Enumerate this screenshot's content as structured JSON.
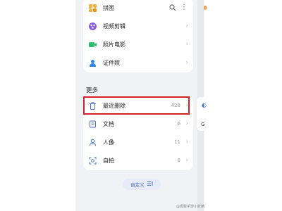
{
  "top_items": [
    {
      "label": "拼图",
      "icon": "puzzle-icon"
    },
    {
      "label": "视频剪辑",
      "icon": "video-edit-icon"
    },
    {
      "label": "照片电影",
      "icon": "movie-icon"
    },
    {
      "label": "证件照",
      "icon": "id-photo-icon"
    }
  ],
  "more": {
    "title": "更多",
    "items": [
      {
        "label": "最近删除",
        "count": "428",
        "icon": "trash-icon"
      },
      {
        "label": "文档",
        "count": "6",
        "icon": "document-icon"
      },
      {
        "label": "人像",
        "count": "11",
        "icon": "person-icon"
      },
      {
        "label": "自拍",
        "count": "8",
        "icon": "selfie-icon"
      }
    ]
  },
  "custom_button": {
    "label": "自定义"
  },
  "peek": {
    "text": "G"
  },
  "watermark": "@极致手游小妖精"
}
